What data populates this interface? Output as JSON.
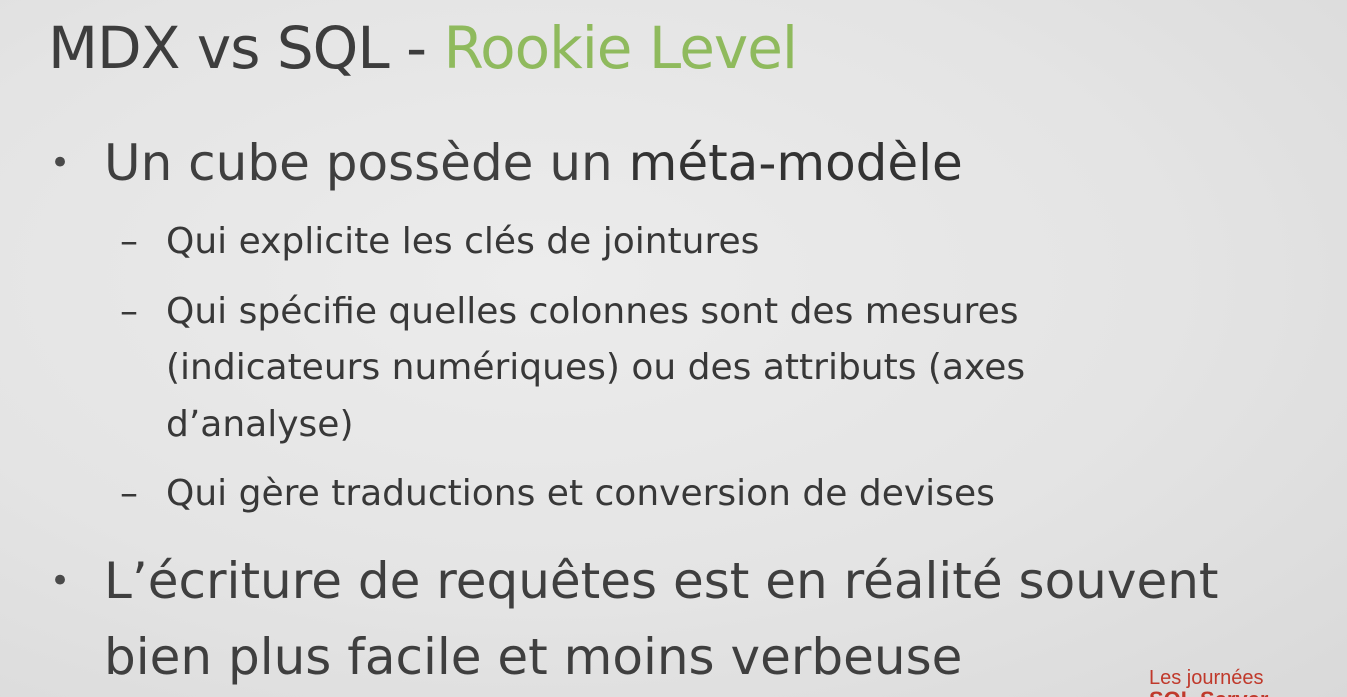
{
  "slide": {
    "title_main": "MDX vs SQL - ",
    "title_accent": "Rookie Level",
    "bullets": [
      {
        "text_pre": "Un cube possède un ",
        "text_emph": "méta-modèle",
        "sub": [
          {
            "lines": [
              "Qui explicite les clés de jointures"
            ]
          },
          {
            "lines": [
              "Qui spécifie quelles colonnes sont des mesures",
              "(indicateurs numériques) ou des attributs (axes",
              "d’analyse)"
            ]
          },
          {
            "lines": [
              "Qui gère traductions et conversion de devises"
            ]
          }
        ]
      },
      {
        "lines": [
          "L’écriture de requêtes est en réalité souvent",
          "bien plus facile et moins verbeuse"
        ]
      }
    ],
    "bullet_glyph": "•",
    "dash_glyph": "–"
  },
  "branding": {
    "line1": "Les journées",
    "line2": "SQL Server"
  },
  "colors": {
    "accent": "#8fba5d",
    "brand": "#c0392b",
    "text": "#3d3d3d"
  }
}
